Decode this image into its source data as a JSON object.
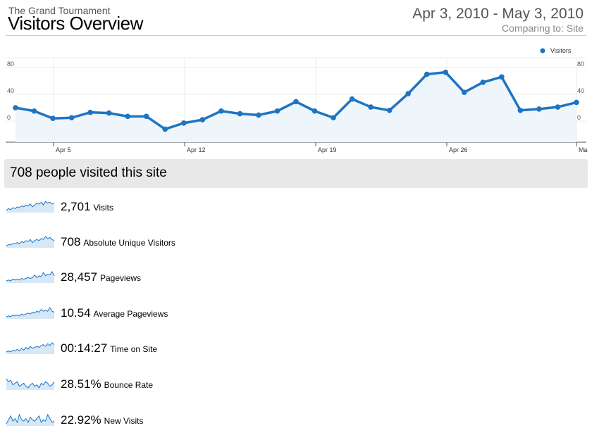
{
  "header": {
    "site_name": "The Grand Tournament",
    "title": "Visitors Overview",
    "date_range": "Apr 3, 2010 - May 3, 2010",
    "comparing": "Comparing to: Site"
  },
  "colors": {
    "line": "#1f74c2",
    "fill": "#eef5fb",
    "summary_bg": "#e8e8e8"
  },
  "chart_data": {
    "type": "line",
    "x": [
      "Apr 3",
      "Apr 4",
      "Apr 5",
      "Apr 6",
      "Apr 7",
      "Apr 8",
      "Apr 9",
      "Apr 10",
      "Apr 11",
      "Apr 12",
      "Apr 13",
      "Apr 14",
      "Apr 15",
      "Apr 16",
      "Apr 17",
      "Apr 18",
      "Apr 19",
      "Apr 20",
      "Apr 21",
      "Apr 22",
      "Apr 23",
      "Apr 24",
      "Apr 25",
      "Apr 26",
      "Apr 27",
      "Apr 28",
      "Apr 29",
      "Apr 30",
      "May 1",
      "May 2",
      "May 3"
    ],
    "series": [
      {
        "name": "Visitors",
        "values": [
          20,
          15,
          4,
          5,
          13,
          12,
          7,
          7,
          -12,
          -3,
          2,
          15,
          11,
          9,
          15,
          29,
          15,
          5,
          33,
          21,
          16,
          41,
          70,
          73,
          43,
          58,
          66,
          16,
          18,
          21,
          28
        ]
      }
    ],
    "xtick_labels": [
      "Apr 5",
      "Apr 12",
      "Apr 19",
      "Apr 26",
      "Ma"
    ],
    "yticks": [
      0,
      40,
      80
    ],
    "ylim": [
      -30,
      95
    ],
    "grid": true,
    "legend": "top-right"
  },
  "summary": {
    "text": "708 people visited this site"
  },
  "metrics": [
    {
      "value": "2,701",
      "label": "Visits",
      "spark": [
        3,
        5,
        4,
        6,
        5,
        7,
        6,
        8,
        7,
        9,
        8,
        10,
        7,
        9,
        11,
        10,
        12,
        9,
        13,
        11,
        12,
        10,
        11
      ]
    },
    {
      "value": "708",
      "label": "Absolute Unique Visitors",
      "spark": [
        3,
        4,
        4,
        5,
        5,
        6,
        5,
        7,
        6,
        8,
        7,
        9,
        6,
        8,
        9,
        8,
        10,
        9,
        12,
        10,
        11,
        9,
        8
      ]
    },
    {
      "value": "28,457",
      "label": "Pageviews",
      "spark": [
        2,
        3,
        2,
        4,
        3,
        4,
        3,
        5,
        4,
        5,
        6,
        5,
        6,
        9,
        6,
        8,
        7,
        12,
        8,
        10,
        9,
        13,
        8
      ]
    },
    {
      "value": "10.54",
      "label": "Average Pageviews",
      "spark": [
        3,
        4,
        3,
        5,
        4,
        5,
        4,
        6,
        5,
        6,
        7,
        6,
        8,
        7,
        9,
        8,
        11,
        9,
        10,
        9,
        13,
        9,
        8
      ]
    },
    {
      "value": "00:14:27",
      "label": "Time on Site",
      "spark": [
        2,
        3,
        2,
        4,
        3,
        5,
        3,
        6,
        4,
        7,
        5,
        8,
        6,
        7,
        8,
        7,
        9,
        10,
        8,
        11,
        9,
        12,
        10
      ]
    },
    {
      "value": "28.51%",
      "label": "Bounce Rate",
      "spark": [
        12,
        10,
        11,
        8,
        9,
        10,
        7,
        8,
        9,
        7,
        6,
        8,
        9,
        7,
        8,
        6,
        9,
        8,
        10,
        9,
        7,
        8,
        10
      ]
    },
    {
      "value": "22.92%",
      "label": "New Visits",
      "spark": [
        5,
        8,
        11,
        7,
        9,
        6,
        12,
        8,
        7,
        9,
        6,
        10,
        8,
        7,
        9,
        11,
        6,
        8,
        7,
        12,
        9,
        6,
        7
      ]
    }
  ]
}
